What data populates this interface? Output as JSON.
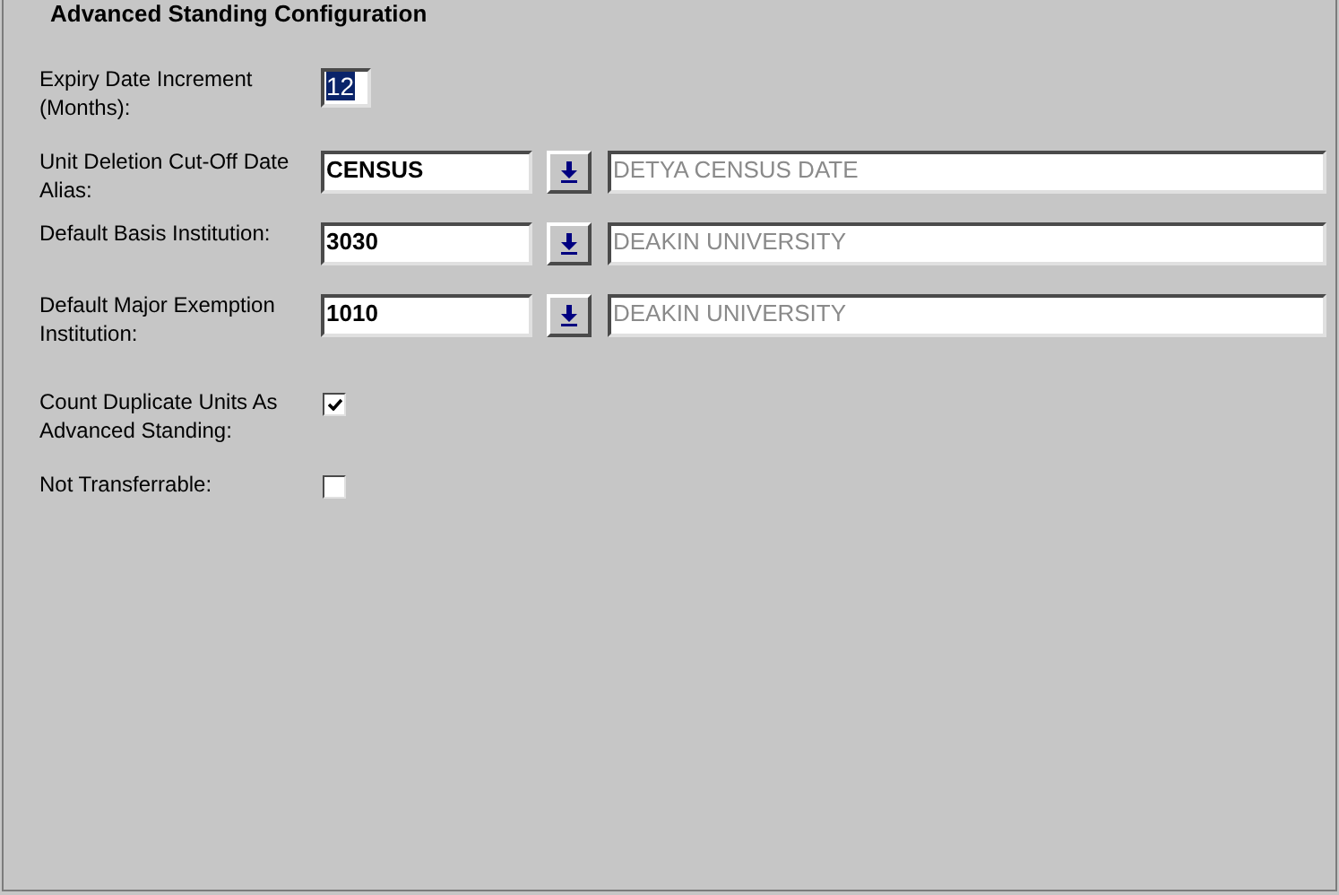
{
  "panel": {
    "title": "Advanced Standing Configuration"
  },
  "rows": [
    {
      "kind": "number",
      "label": "Expiry Date Increment (Months):",
      "value": "12",
      "text_selected": true
    },
    {
      "kind": "lookup",
      "label": "Unit Deletion Cut-Off Date Alias:",
      "value": "CENSUS",
      "description": "DETYA CENSUS DATE"
    },
    {
      "kind": "lookup",
      "label": "Default Basis Institution:",
      "value": "3030",
      "description": "DEAKIN UNIVERSITY"
    },
    {
      "kind": "lookup",
      "label": "Default Major Exemption Institution:",
      "value": "1010",
      "description": "DEAKIN UNIVERSITY"
    },
    {
      "kind": "checkbox",
      "label": "Count Duplicate Units As Advanced Standing:",
      "checked": true
    },
    {
      "kind": "checkbox",
      "label": "Not Transferrable:",
      "checked": false
    }
  ]
}
